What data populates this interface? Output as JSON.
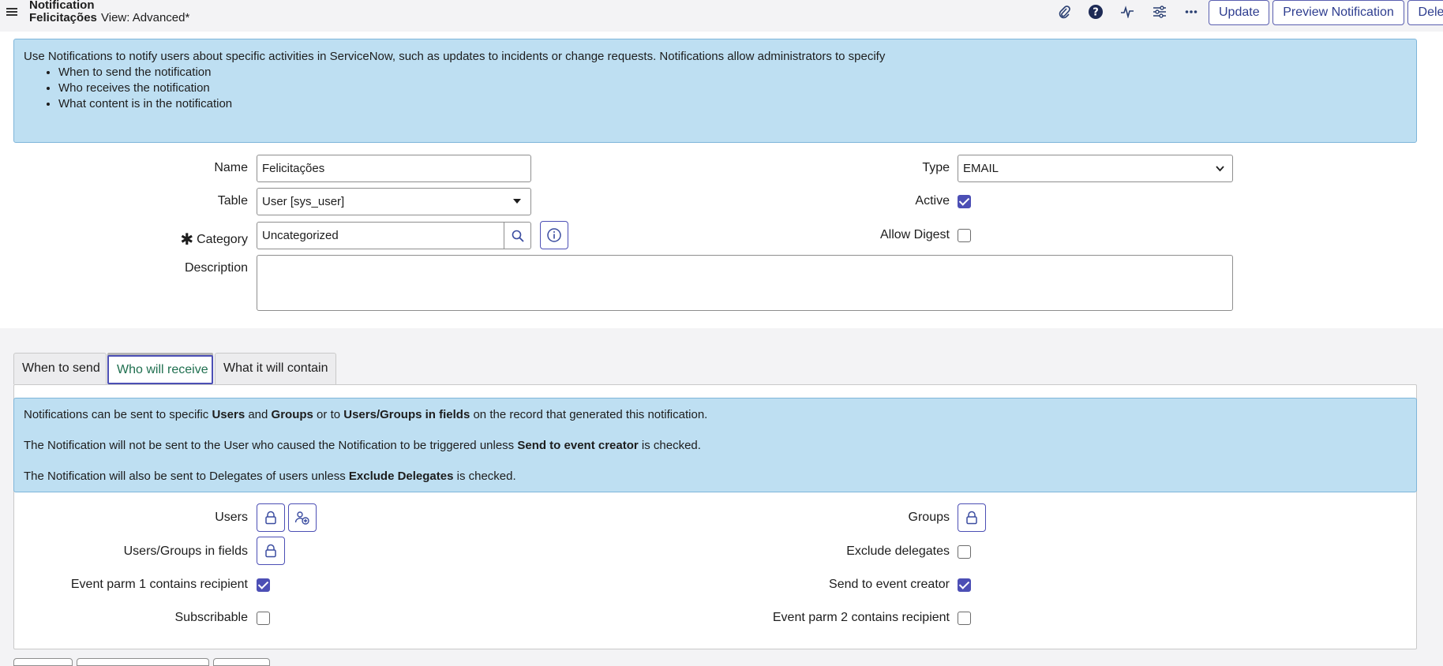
{
  "header": {
    "record_type": "Notification",
    "record_name": "Felicitações",
    "view": "View: Advanced*",
    "buttons": {
      "update": "Update",
      "preview": "Preview Notification",
      "delete": "Dele"
    },
    "icons": [
      "paperclip-icon",
      "help-icon",
      "activity-icon",
      "settings-sliders-icon",
      "more-icon"
    ]
  },
  "intro": {
    "text": "Use Notifications to notify users about specific activities in ServiceNow, such as updates to incidents or change requests. Notifications allow administrators to specify",
    "bullets": [
      "When to send the notification",
      "Who receives the notification",
      "What content is in the notification"
    ]
  },
  "form": {
    "name_label": "Name",
    "name_value": "Felicitações",
    "table_label": "Table",
    "table_value": "User [sys_user]",
    "category_label": "Category",
    "category_value": "Uncategorized",
    "description_label": "Description",
    "description_value": "",
    "type_label": "Type",
    "type_value": "EMAIL",
    "active_label": "Active",
    "active_checked": true,
    "allow_digest_label": "Allow Digest",
    "allow_digest_checked": false
  },
  "tabs": [
    {
      "label": "When to send",
      "active": false
    },
    {
      "label": "Who will receive",
      "active": true
    },
    {
      "label": "What it will contain",
      "active": false
    }
  ],
  "receive_info": {
    "p1": {
      "a": "Notifications can be sent to specific ",
      "b1": "Users",
      "c": " and ",
      "b2": "Groups",
      "d": " or to ",
      "b3": "Users/Groups in fields",
      "e": " on the record that generated this notification."
    },
    "p2": {
      "a": "The Notification will not be sent to the User who caused the Notification to be triggered unless ",
      "b": "Send to event creator",
      "c": " is checked."
    },
    "p3": {
      "a": "The Notification will also be sent to Delegates of users unless ",
      "b": "Exclude Delegates",
      "c": " is checked."
    }
  },
  "recipients": {
    "users_label": "Users",
    "groups_label": "Groups",
    "users_in_fields_label": "Users/Groups in fields",
    "exclude_delegates_label": "Exclude delegates",
    "exclude_delegates_checked": false,
    "event_parm1_label": "Event parm 1 contains recipient",
    "event_parm1_checked": true,
    "send_to_creator_label": "Send to event creator",
    "send_to_creator_checked": true,
    "subscribable_label": "Subscribable",
    "subscribable_checked": false,
    "event_parm2_label": "Event parm 2 contains recipient",
    "event_parm2_checked": false
  },
  "colors": {
    "accent": "#4c4fb5",
    "info_bg": "#bedff2",
    "active_tab_text": "#1f6f4f"
  }
}
